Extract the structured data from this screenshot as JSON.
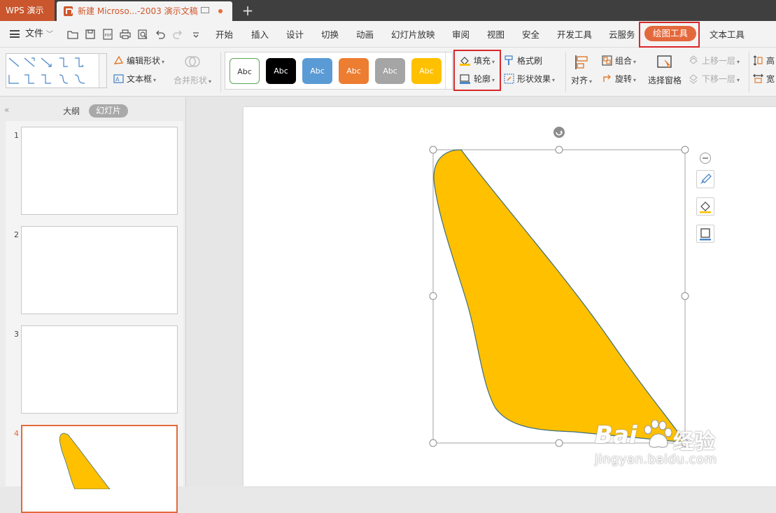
{
  "titlebar": {
    "app_name": "WPS 演示",
    "doc_tab": "新建 Microso...-2003 演示文稿",
    "new_tab": "+"
  },
  "menubar": {
    "file_label": "文件",
    "items": [
      "开始",
      "插入",
      "设计",
      "切换",
      "动画",
      "幻灯片放映",
      "审阅",
      "视图",
      "安全",
      "开发工具",
      "云服务",
      "绘图工具",
      "文本工具"
    ],
    "active_item": "绘图工具"
  },
  "ribbon": {
    "edit_shape": "编辑形状",
    "text_box": "文本框",
    "merge_shape": "合并形状",
    "style_swatches": [
      {
        "label": "Abc",
        "bg": "#ffffff",
        "fg": "#333333",
        "border": "#5aa657"
      },
      {
        "label": "Abc",
        "bg": "#000000",
        "fg": "#ffffff",
        "border": "#000000"
      },
      {
        "label": "Abc",
        "bg": "#5b9bd5",
        "fg": "#ffffff",
        "border": "#5b9bd5"
      },
      {
        "label": "Abc",
        "bg": "#ed7d31",
        "fg": "#ffffff",
        "border": "#ed7d31"
      },
      {
        "label": "Abc",
        "bg": "#a5a5a5",
        "fg": "#ffffff",
        "border": "#a5a5a5"
      },
      {
        "label": "Abc",
        "bg": "#ffc000",
        "fg": "#ffffff",
        "border": "#ffc000"
      }
    ],
    "fill": "填充",
    "outline": "轮廓",
    "format_painter": "格式刷",
    "shape_effects": "形状效果",
    "align": "对齐",
    "group": "组合",
    "rotate": "旋转",
    "selection_pane": "选择窗格",
    "bring_forward": "上移一层",
    "send_backward": "下移一层",
    "height_abbr": "高",
    "width_abbr": "宽"
  },
  "leftpanel": {
    "tab_outline": "大纲",
    "tab_slides": "幻灯片",
    "slides": [
      "1",
      "2",
      "3",
      "4"
    ],
    "active_slide": "4"
  },
  "colors": {
    "accent": "#e3683c",
    "shape_fill": "#ffc000",
    "shape_stroke": "#3f6f7a",
    "highlight_box": "#d9262a"
  },
  "watermark": {
    "brand": "Bai",
    "brand_cn": "经验",
    "url": "jingyan.baidu.com"
  }
}
